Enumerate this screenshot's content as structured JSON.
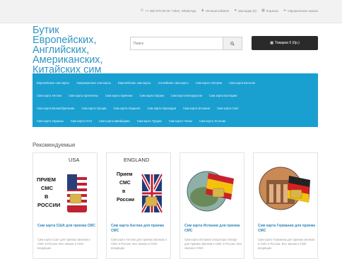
{
  "topbar": {
    "phone": "+7 495 979 00 00 / Viber, WhatsApp",
    "login": "Личный кабинет",
    "wishlist": "Закладки (0)",
    "cart": "Корзина",
    "checkout": "Оформление заказа"
  },
  "header": {
    "logo_lines": [
      "Бутик Европейских,",
      "Английских,",
      "Американских,",
      "Китайских сим карт"
    ],
    "search_placeholder": "Поиск",
    "cart_button": "Товаров 0 (0p.)"
  },
  "nav": {
    "rows": [
      [
        "Европейские сим карты",
        "Американские сим карты",
        "Европейские сим карты",
        "Английские сим карты",
        "Сим карта Австрии",
        "Сим карта Бельгии"
      ],
      [
        "Сим карта Англии",
        "Сим карта Аргентины",
        "Сим карта Армении",
        "Сим карта Грузии",
        "Сим карта Белоруссии",
        "Сим карта Болгарии"
      ],
      [
        "Сим карта Великобритании",
        "Сим карта Греции",
        "Сим карта Израиля",
        "Сим карта Ирландии",
        "Сим карта Испании",
        "Сим карта США"
      ],
      [
        "Сим карта Украины",
        "Сим карта ОАЭ",
        "Сим карта Швейцарии",
        "Сим карта Турции",
        "Сим карта Чехии",
        "Сим карта Эстонии"
      ]
    ]
  },
  "recommended": {
    "title": "Рекомендуемые",
    "products": [
      {
        "label": "USA",
        "sign": [
          "ПРИЕМ",
          "СМС",
          "В",
          "РОССИИ"
        ],
        "title": "Сим карта США для приема СМС",
        "desc": "Сим карта США для приема звонков и СМС в России. Все звонки и СМС входящие"
      },
      {
        "label": "ENGLAND",
        "sign": [
          "Прием",
          "СМС",
          "в",
          "России"
        ],
        "title": "Сим карта Англии для приема СМС",
        "desc": "Сим карта Англии для приема звонков и СМС в России. Все звонки и СМС входящие"
      },
      {
        "label": "",
        "sign": [],
        "title": "Сим карта Испании для приема СМС",
        "desc": "Сим карта Испании оператора Orange для приема звонков и СМС в России. Все звонки и СМС"
      },
      {
        "label": "",
        "sign": [],
        "title": "Сим карта Германии для приема СМС",
        "desc": "Сим карта Германии для приема звонков и СМС в России. Все звонки и СМС входящие"
      }
    ]
  }
}
